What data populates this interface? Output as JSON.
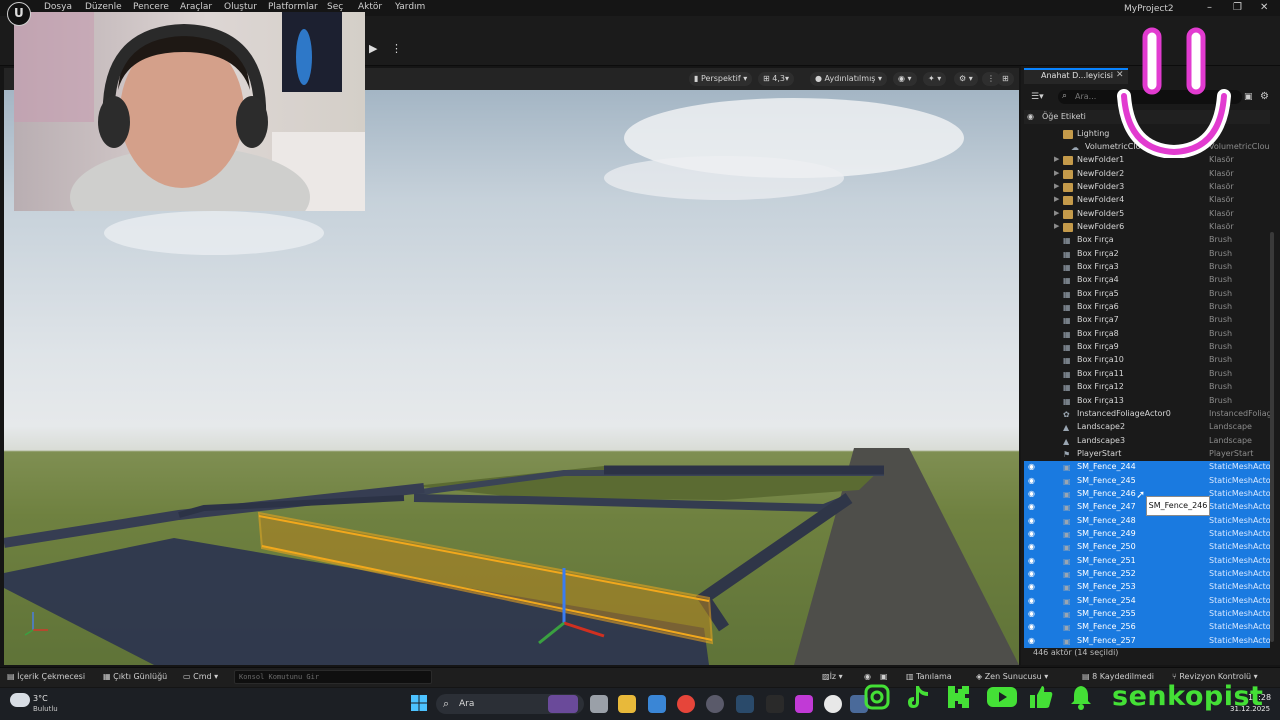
{
  "menu": {
    "logo_label": "U",
    "items": [
      "Dosya",
      "Düzenle",
      "Pencere",
      "Araçlar",
      "Oluştur",
      "Platformlar",
      "Seç",
      "Aktör",
      "Yardım"
    ],
    "project": "MyProject2",
    "win_buttons": [
      "–",
      "❐",
      "✕"
    ]
  },
  "viewport": {
    "view_mode": "Perspektif",
    "grid_value": "4,3",
    "lighting": "Aydınlatılmış"
  },
  "outliner": {
    "tab_title": "Anahat D...leyicisi",
    "search_placeholder": "Ara...",
    "column_label": "Öğe Etiketi",
    "footer": "446 aktör (14 seçildi)",
    "tooltip": "SM_Fence_246",
    "rows": [
      {
        "name": "Lighting",
        "type": "",
        "icon": "folder",
        "indent": 1,
        "selected": false
      },
      {
        "name": "VolumetricClou",
        "type": "VolumetricClou",
        "icon": "actor",
        "indent": 2,
        "selected": false
      },
      {
        "name": "NewFolder1",
        "type": "Klasör",
        "icon": "folder",
        "indent": 0,
        "selected": false
      },
      {
        "name": "NewFolder2",
        "type": "Klasör",
        "icon": "folder",
        "indent": 0,
        "selected": false
      },
      {
        "name": "NewFolder3",
        "type": "Klasör",
        "icon": "folder",
        "indent": 0,
        "selected": false
      },
      {
        "name": "NewFolder4",
        "type": "Klasör",
        "icon": "folder",
        "indent": 0,
        "selected": false
      },
      {
        "name": "NewFolder5",
        "type": "Klasör",
        "icon": "folder",
        "indent": 0,
        "selected": false
      },
      {
        "name": "NewFolder6",
        "type": "Klasör",
        "icon": "folder",
        "indent": 0,
        "selected": false
      },
      {
        "name": "Box Fırça",
        "type": "Brush",
        "icon": "brush",
        "indent": 0,
        "selected": false
      },
      {
        "name": "Box Fırça2",
        "type": "Brush",
        "icon": "brush",
        "indent": 0,
        "selected": false
      },
      {
        "name": "Box Fırça3",
        "type": "Brush",
        "icon": "brush",
        "indent": 0,
        "selected": false
      },
      {
        "name": "Box Fırça4",
        "type": "Brush",
        "icon": "brush",
        "indent": 0,
        "selected": false
      },
      {
        "name": "Box Fırça5",
        "type": "Brush",
        "icon": "brush",
        "indent": 0,
        "selected": false
      },
      {
        "name": "Box Fırça6",
        "type": "Brush",
        "icon": "brush",
        "indent": 0,
        "selected": false
      },
      {
        "name": "Box Fırça7",
        "type": "Brush",
        "icon": "brush",
        "indent": 0,
        "selected": false
      },
      {
        "name": "Box Fırça8",
        "type": "Brush",
        "icon": "brush",
        "indent": 0,
        "selected": false
      },
      {
        "name": "Box Fırça9",
        "type": "Brush",
        "icon": "brush",
        "indent": 0,
        "selected": false
      },
      {
        "name": "Box Fırça10",
        "type": "Brush",
        "icon": "brush",
        "indent": 0,
        "selected": false
      },
      {
        "name": "Box Fırça11",
        "type": "Brush",
        "icon": "brush",
        "indent": 0,
        "selected": false
      },
      {
        "name": "Box Fırça12",
        "type": "Brush",
        "icon": "brush",
        "indent": 0,
        "selected": false
      },
      {
        "name": "Box Fırça13",
        "type": "Brush",
        "icon": "brush",
        "indent": 0,
        "selected": false
      },
      {
        "name": "InstancedFoliageActor0",
        "type": "InstancedFoliag",
        "icon": "foliage",
        "indent": 0,
        "selected": false
      },
      {
        "name": "Landscape2",
        "type": "Landscape",
        "icon": "landscape",
        "indent": 0,
        "selected": false
      },
      {
        "name": "Landscape3",
        "type": "Landscape",
        "icon": "landscape",
        "indent": 0,
        "selected": false
      },
      {
        "name": "PlayerStart",
        "type": "PlayerStart",
        "icon": "flag",
        "indent": 0,
        "selected": false
      },
      {
        "name": "SM_Fence_244",
        "type": "StaticMeshActo",
        "icon": "mesh",
        "indent": 0,
        "selected": true
      },
      {
        "name": "SM_Fence_245",
        "type": "StaticMeshActo",
        "icon": "mesh",
        "indent": 0,
        "selected": true
      },
      {
        "name": "SM_Fence_246",
        "type": "StaticMeshActo",
        "icon": "mesh",
        "indent": 0,
        "selected": true
      },
      {
        "name": "SM_Fence_247",
        "type": "StaticMeshActo",
        "icon": "mesh",
        "indent": 0,
        "selected": true
      },
      {
        "name": "SM_Fence_248",
        "type": "StaticMeshActo",
        "icon": "mesh",
        "indent": 0,
        "selected": true
      },
      {
        "name": "SM_Fence_249",
        "type": "StaticMeshActo",
        "icon": "mesh",
        "indent": 0,
        "selected": true
      },
      {
        "name": "SM_Fence_250",
        "type": "StaticMeshActo",
        "icon": "mesh",
        "indent": 0,
        "selected": true
      },
      {
        "name": "SM_Fence_251",
        "type": "StaticMeshActo",
        "icon": "mesh",
        "indent": 0,
        "selected": true
      },
      {
        "name": "SM_Fence_252",
        "type": "StaticMeshActo",
        "icon": "mesh",
        "indent": 0,
        "selected": true
      },
      {
        "name": "SM_Fence_253",
        "type": "StaticMeshActo",
        "icon": "mesh",
        "indent": 0,
        "selected": true
      },
      {
        "name": "SM_Fence_254",
        "type": "StaticMeshActo",
        "icon": "mesh",
        "indent": 0,
        "selected": true
      },
      {
        "name": "SM_Fence_255",
        "type": "StaticMeshActo",
        "icon": "mesh",
        "indent": 0,
        "selected": true
      },
      {
        "name": "SM_Fence_256",
        "type": "StaticMeshActo",
        "icon": "mesh",
        "indent": 0,
        "selected": true
      },
      {
        "name": "SM_Fence_257",
        "type": "StaticMeshActo",
        "icon": "mesh",
        "indent": 0,
        "selected": true
      }
    ]
  },
  "statusbar": {
    "content_drawer": "İçerik Çekmecesi",
    "output_log": "Çıktı Günlüğü",
    "cmd": "Cmd",
    "console_placeholder": "Konsol Komutunu Gir",
    "trace": "İz",
    "derived": "Tanılama",
    "zen": "Zen Sunucusu",
    "unsaved": "8 Kaydedilmedi",
    "revision": "Revizyon Kontrolü"
  },
  "taskbar": {
    "temperature": "3°C",
    "weather": "Bulutlu",
    "search_label": "Ara",
    "time": "11:28",
    "date": "31.12.2025"
  },
  "overlay": {
    "handle": "senkopist"
  },
  "colors": {
    "selection": "#1a7ae0",
    "accent": "#0a84ff",
    "overlay_pink": "#e23bd0",
    "social_green": "#44e036",
    "fence_highlight": "#f2a81c"
  }
}
